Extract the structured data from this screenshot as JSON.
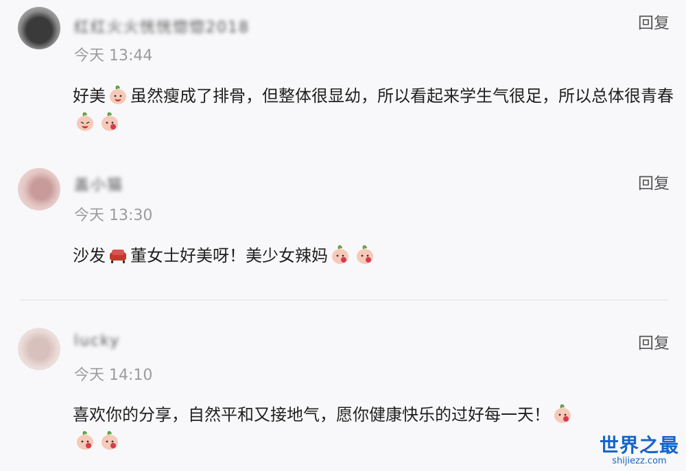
{
  "comments": [
    {
      "username": "红红火火恍恍惚惚2018",
      "time": "今天 13:44",
      "reply_label": "回复",
      "text_1": "好美",
      "text_2": "虽然瘦成了排骨，但整体很显幼，所以看起来学生气很足，所以总体很青春"
    },
    {
      "username": "盖小猫",
      "time": "今天 13:30",
      "reply_label": "回复",
      "text_1": "沙发",
      "text_2": "董女士好美呀！美少女辣妈"
    },
    {
      "username": "lucky",
      "time": "今天 14:10",
      "reply_label": "回复",
      "text_1": "喜欢你的分享，自然平和又接地气，愿你健康快乐的过好每一天！"
    }
  ],
  "emoji_icons": [
    "peach-emoji-icon",
    "sofa-emoji-icon"
  ],
  "colors": {
    "accent": "#1565c8",
    "time": "#9b9b9b"
  },
  "watermark": {
    "main": "世界之最",
    "sub": "shijiezz.com"
  }
}
